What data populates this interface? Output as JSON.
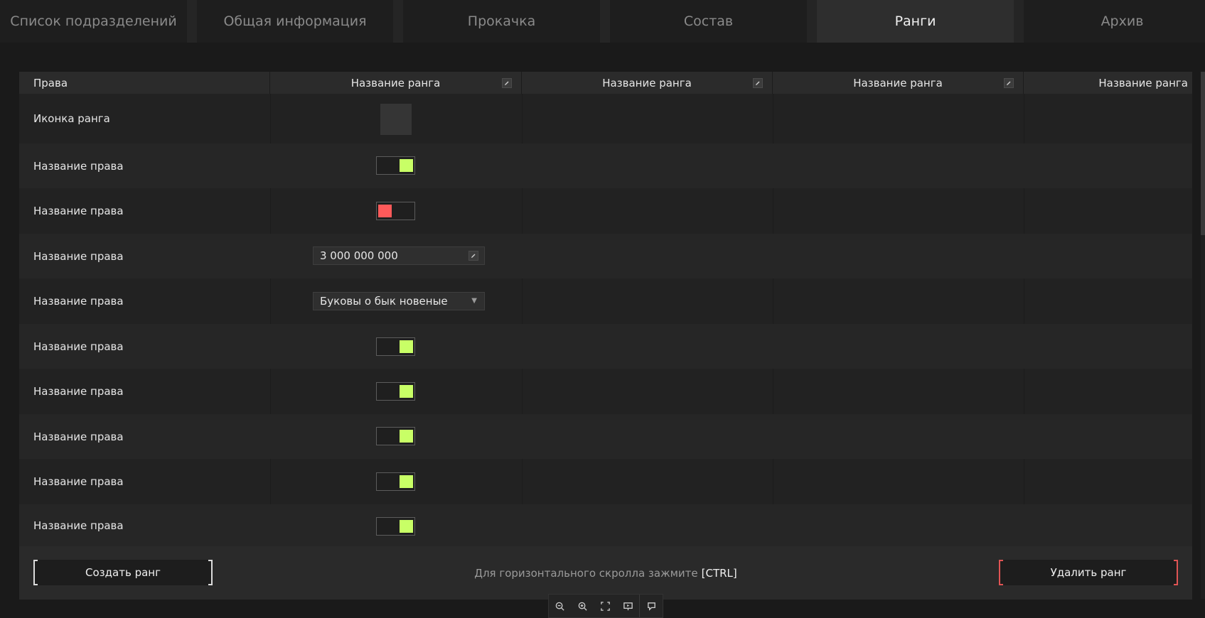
{
  "tabs": [
    {
      "label": "Список подразделений",
      "active": false
    },
    {
      "label": "Общая информация",
      "active": false
    },
    {
      "label": "Прокачка",
      "active": false
    },
    {
      "label": "Состав",
      "active": false
    },
    {
      "label": "Ранги",
      "active": true
    },
    {
      "label": "Архив",
      "active": false
    }
  ],
  "table": {
    "rights_header": "Права",
    "rank_columns": [
      "Название ранга",
      "Название ранга",
      "Название ранга",
      "Название ранга"
    ],
    "rows": [
      {
        "label": "Иконка ранга",
        "control": "icon"
      },
      {
        "label": "Название права",
        "control": "toggle",
        "state": "on"
      },
      {
        "label": "Название права",
        "control": "toggle",
        "state": "off"
      },
      {
        "label": "Название права",
        "control": "number",
        "value": "3 000 000 000"
      },
      {
        "label": "Название права",
        "control": "select",
        "value": "Буковы о бык новеные"
      },
      {
        "label": "Название права",
        "control": "toggle",
        "state": "on"
      },
      {
        "label": "Название права",
        "control": "toggle",
        "state": "on"
      },
      {
        "label": "Название права",
        "control": "toggle",
        "state": "on"
      },
      {
        "label": "Название права",
        "control": "toggle",
        "state": "on"
      },
      {
        "label": "Название права",
        "control": "toggle",
        "state": "on"
      }
    ]
  },
  "footer": {
    "create_label": "Создать ранг",
    "hint_text": "Для горизонтального скролла зажмите",
    "hint_key": "[CTRL]",
    "delete_label": "Удалить ранг"
  },
  "colors": {
    "toggle_on": "#c8ff66",
    "toggle_off": "#ff5a5a",
    "danger_accent": "#e05454"
  },
  "zoom_toolbar": {
    "icons": [
      "zoom-out-icon",
      "zoom-in-icon",
      "fit-screen-icon",
      "presentation-icon",
      "comment-icon"
    ]
  }
}
